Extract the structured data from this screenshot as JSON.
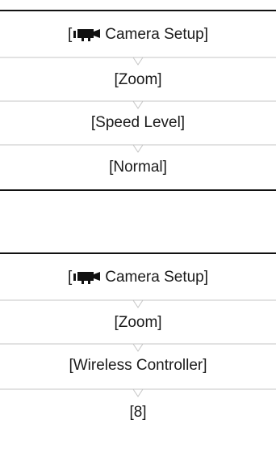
{
  "colors": {
    "rule": "#111111",
    "separator": "#c4c4c4",
    "text": "#1a1a1a"
  },
  "blocks": [
    {
      "menu": {
        "bracket_open": "[",
        "icon": "movie-camera-icon",
        "label": "Camera Setup]"
      },
      "steps": [
        "[Zoom]",
        "[Speed Level]",
        "[Normal]"
      ]
    },
    {
      "menu": {
        "bracket_open": "[",
        "icon": "movie-camera-icon",
        "label": "Camera Setup]"
      },
      "steps": [
        "[Zoom]",
        "[Wireless Controller]",
        "[8]"
      ]
    }
  ]
}
